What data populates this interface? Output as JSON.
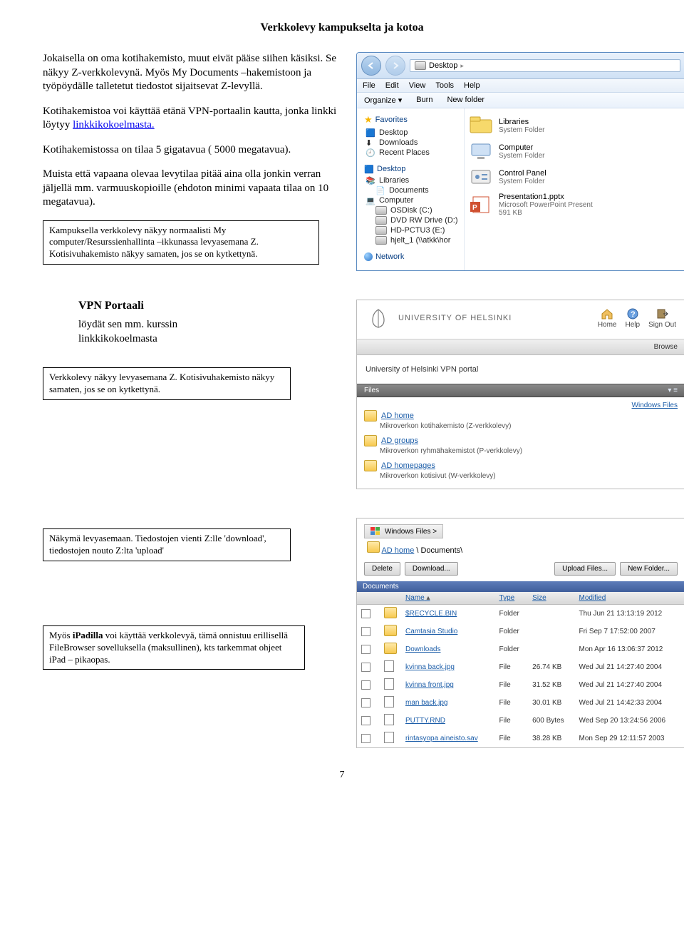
{
  "pageTitle": "Verkkolevy kampukselta ja kotoa",
  "pageNumber": "7",
  "paragraphs": {
    "p1": "Jokaisella on oma kotihakemisto, muut eivät pääse siihen käsiksi. Se näkyy Z-verkkolevynä. Myös My Documents –hakemistoon ja työpöydälle talletetut tiedostot sijaitsevat Z-levyllä.",
    "p2a": "Kotihakemistoa voi käyttää etänä VPN-portaalin kautta, jonka linkki löytyy ",
    "p2link": "linkkikokoelmasta.",
    "p3": "Kotihakemistossa on tilaa 5 gigatavua ( 5000 megatavua).",
    "p4": "Muista että vapaana olevaa levytilaa pitää aina olla jonkin verran jäljellä mm. varmuuskopioille (ehdoton minimi vapaata tilaa on 10 megatavua)."
  },
  "callouts": {
    "c1": "Kampuksella verkkolevy näkyy normaalisti My computer/Resurssienhallinta –ikkunassa levyasemana Z. Kotisivuhakemisto näkyy samaten, jos se on kytkettynä.",
    "vpn_h": "VPN Portaali",
    "vpn_p": "löydät sen mm. kurssin linkkikokoelmasta",
    "c2": "Verkkolevy näkyy levyasemana Z. Kotisivuhakemisto näkyy samaten, jos se on kytkettynä.",
    "c3": "Näkymä levyasemaan. Tiedostojen vienti Z:lle 'download', tiedostojen nouto Z:lta 'upload'",
    "c4": "Myös iPadilla voi käyttää verkkolevyä, tämä onnistuu erillisellä FileBrowser sovelluksella (maksullinen), kts tarkemmat ohjeet iPad – pikaopas."
  },
  "explorer": {
    "address": "Desktop",
    "menus": [
      "File",
      "Edit",
      "View",
      "Tools",
      "Help"
    ],
    "toolbar": [
      "Organize ▾",
      "Burn",
      "New folder"
    ],
    "favorites_h": "Favorites",
    "favorites": [
      "Desktop",
      "Downloads",
      "Recent Places"
    ],
    "desktop_h": "Desktop",
    "desktop_items": [
      "Libraries",
      "Documents",
      "Computer",
      "OSDisk (C:)",
      "DVD RW Drive (D:)",
      "HD-PCTU3 (E:)",
      "hjelt_1 (\\\\atkk\\hor"
    ],
    "network_h": "Network",
    "tiles": [
      {
        "t": "Libraries",
        "s": "System Folder",
        "ic": "libs"
      },
      {
        "t": "Computer",
        "s": "System Folder",
        "ic": "pc"
      },
      {
        "t": "Control Panel",
        "s": "System Folder",
        "ic": "cp"
      },
      {
        "t": "Presentation1.pptx",
        "s": "Microsoft PowerPoint Present",
        "s2": "591 KB",
        "ic": "ppt"
      }
    ]
  },
  "vpn1": {
    "uni": "UNIVERSITY OF HELSINKI",
    "icons": [
      "Home",
      "Help",
      "Sign Out"
    ],
    "browse": "Browse",
    "welcome": "University of Helsinki VPN portal",
    "files": "Files",
    "winfiles": "Windows Files",
    "items": [
      {
        "t": "AD home",
        "d": "Mikroverkon kotihakemisto (Z-verkkolevy)"
      },
      {
        "t": "AD groups",
        "d": "Mikroverkon ryhmähakemistot (P-verkkolevy)"
      },
      {
        "t": "AD homepages",
        "d": "Mikroverkon kotisivut (W-verkkolevy)"
      }
    ]
  },
  "vpn2": {
    "crumb_prefix": "Windows Files >",
    "crumb_link": "AD home",
    "crumb_tail": "\\ Documents\\",
    "btns_left": [
      "Delete",
      "Download..."
    ],
    "btns_right": [
      "Upload Files...",
      "New Folder..."
    ],
    "docbar": "Documents",
    "cols": [
      "Name",
      "Type",
      "Size",
      "Modified"
    ],
    "rows": [
      {
        "n": "$RECYCLE.BIN",
        "t": "Folder",
        "s": "",
        "m": "Thu Jun 21 13:13:19 2012"
      },
      {
        "n": "Camtasia Studio",
        "t": "Folder",
        "s": "",
        "m": "Fri Sep 7 17:52:00 2007"
      },
      {
        "n": "Downloads",
        "t": "Folder",
        "s": "",
        "m": "Mon Apr 16 13:06:37 2012"
      },
      {
        "n": "kvinna back.jpg",
        "t": "File",
        "s": "26.74 KB",
        "m": "Wed Jul 21 14:27:40 2004"
      },
      {
        "n": "kvinna front.jpg",
        "t": "File",
        "s": "31.52 KB",
        "m": "Wed Jul 21 14:27:40 2004"
      },
      {
        "n": "man back.jpg",
        "t": "File",
        "s": "30.01 KB",
        "m": "Wed Jul 21 14:42:33 2004"
      },
      {
        "n": "PUTTY.RND",
        "t": "File",
        "s": "600 Bytes",
        "m": "Wed Sep 20 13:24:56 2006"
      },
      {
        "n": "rintasyopa aineisto.sav",
        "t": "File",
        "s": "38.28 KB",
        "m": "Mon Sep 29 12:11:57 2003"
      }
    ]
  }
}
